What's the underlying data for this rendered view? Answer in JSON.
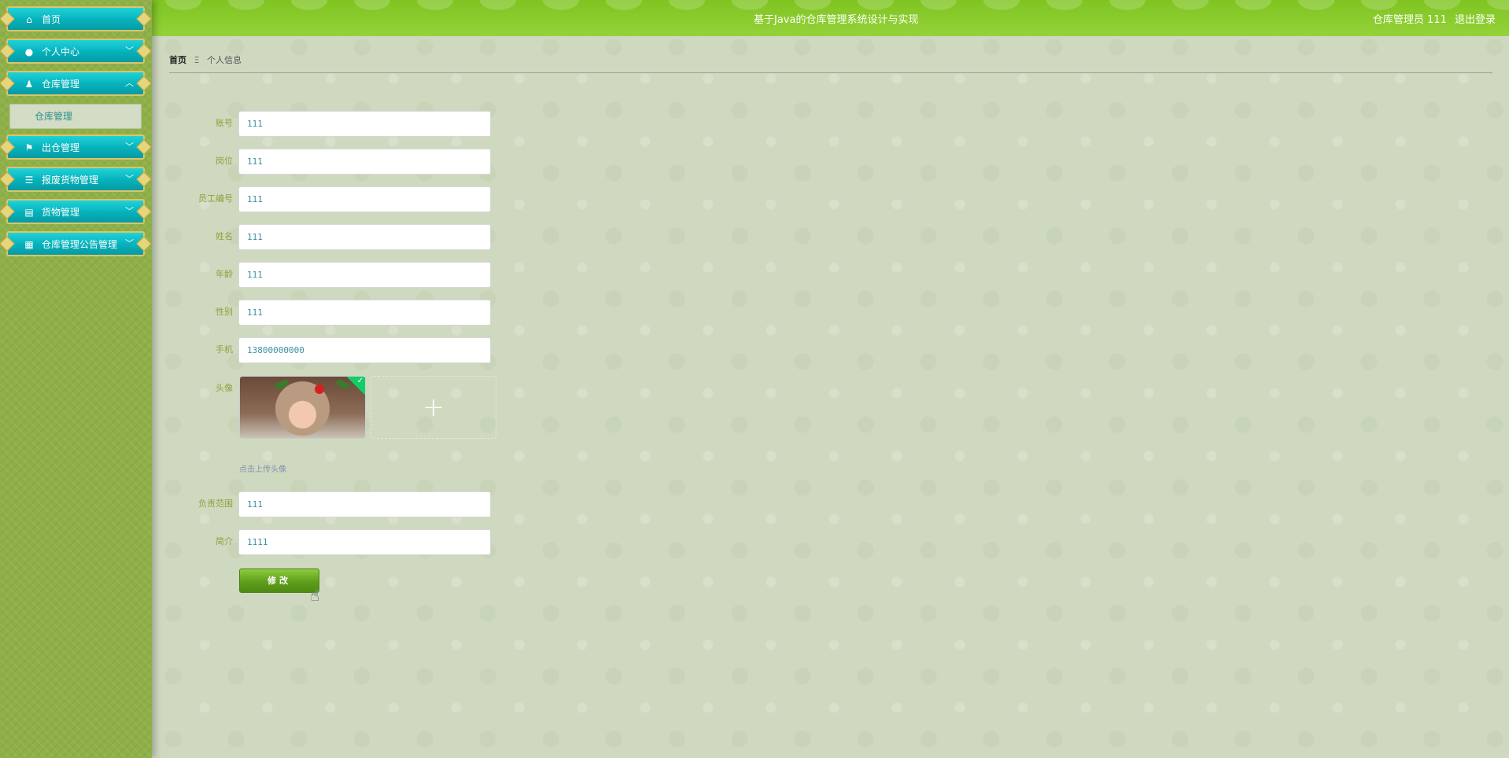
{
  "header": {
    "site_title": "基于Java的仓库管理系统设计与实现",
    "user_label": "仓库管理员 111",
    "logout_label": "退出登录"
  },
  "sidebar": {
    "items": [
      {
        "label": "首页",
        "icon": "home-icon",
        "glyph": "⌂",
        "chevron": ""
      },
      {
        "label": "个人中心",
        "icon": "user-icon",
        "glyph": "●",
        "chevron": "﹀"
      },
      {
        "label": "仓库管理",
        "icon": "stamp-icon",
        "glyph": "♟",
        "chevron": "︿"
      },
      {
        "label": "出仓管理",
        "icon": "flag-icon",
        "glyph": "⚑",
        "chevron": "﹀"
      },
      {
        "label": "报废货物管理",
        "icon": "list-icon",
        "glyph": "☰",
        "chevron": "﹀"
      },
      {
        "label": "货物管理",
        "icon": "clipboard-icon",
        "glyph": "▤",
        "chevron": "﹀"
      },
      {
        "label": "仓库管理公告管理",
        "icon": "grid-icon",
        "glyph": "▦",
        "chevron": "﹀"
      }
    ],
    "submenu": {
      "label": "仓库管理"
    }
  },
  "breadcrumb": {
    "home": "首页",
    "separator": "Ξ",
    "current": "个人信息"
  },
  "form": {
    "fields": [
      {
        "label": "账号",
        "value": "111"
      },
      {
        "label": "岗位",
        "value": "111"
      },
      {
        "label": "员工编号",
        "value": "111"
      },
      {
        "label": "姓名",
        "value": "111"
      },
      {
        "label": "年龄",
        "value": "111"
      },
      {
        "label": "性别",
        "value": "111"
      },
      {
        "label": "手机",
        "value": "13800000000"
      },
      {
        "label": "负责范围",
        "value": "111"
      },
      {
        "label": "简介",
        "value": "1111"
      }
    ],
    "avatar": {
      "label": "头像",
      "upload_plus": "+",
      "hint": "点击上传头像",
      "check": "✓"
    },
    "submit_label": "修改"
  },
  "colors": {
    "topbar": "#85c828",
    "sidebar": "#8fb048",
    "menu_item": "#0bb8c2",
    "label": "#8ea23a",
    "input_text": "#3a8fa0",
    "button": "#5f9e1c"
  }
}
